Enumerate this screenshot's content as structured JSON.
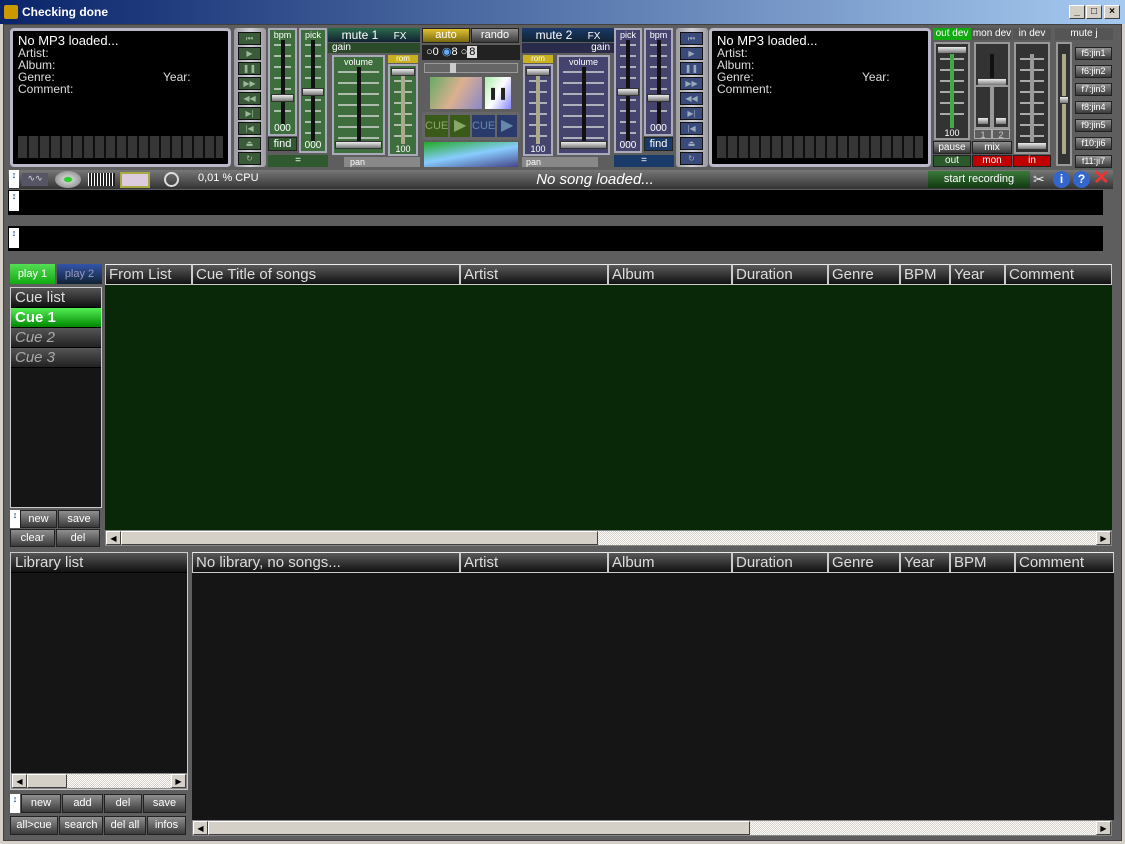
{
  "window": {
    "title": "Checking done",
    "min": "_",
    "max": "□",
    "close": "×"
  },
  "deck1": {
    "title": "No MP3 loaded...",
    "artist": "Artist:",
    "album": "Album:",
    "genre": "Genre:",
    "year": "Year:",
    "comment": "Comment:",
    "bpm_label": "bpm",
    "pitch_label": "pick",
    "bpm_value": "000",
    "pitch_value": "000",
    "find": "find",
    "mute": "mute 1",
    "fx": "FX",
    "gain": "gain",
    "volume": "volume",
    "rom": "rom",
    "rom_value": "100",
    "pan": "pan",
    "eq": "="
  },
  "deck2": {
    "title": "No MP3 loaded...",
    "artist": "Artist:",
    "album": "Album:",
    "genre": "Genre:",
    "year": "Year:",
    "comment": "Comment:",
    "bpm_label": "bpm",
    "pitch_label": "pick",
    "bpm_value": "000",
    "pitch_value": "000",
    "find": "find",
    "mute": "mute 2",
    "fx": "FX",
    "gain": "gain",
    "volume": "volume",
    "rom": "rom",
    "rom_value": "100",
    "pan": "pan",
    "eq": "="
  },
  "center": {
    "auto": "auto",
    "rando": "rando",
    "radio": [
      "0",
      "8"
    ],
    "radio_value": "8",
    "cue1": "CUE",
    "cue2": "CUE",
    "play": "▶",
    "pause": "❚❚"
  },
  "mixer": {
    "out_dev": "out dev",
    "mon_dev": "mon dev",
    "in_dev": "in dev",
    "mute_j": "mute j",
    "out_value": "100",
    "pause": "pause",
    "mix": "mix",
    "ch1": "1",
    "ch2": "2",
    "out": "out",
    "mon": "mon",
    "in": "in",
    "jingles": [
      "f5:jin1",
      "f6:jin2",
      "f7:jin3",
      "f8:jin4",
      "f9:jin5",
      "f10:ji6",
      "f11:ji7"
    ]
  },
  "toolbar": {
    "cpu": "0,01 % CPU",
    "status": "No song loaded...",
    "record": "start recording"
  },
  "tabs": {
    "play1": "play 1",
    "play2": "play 2"
  },
  "cue_table": {
    "columns": [
      "From List",
      "Cue Title of songs",
      "Artist",
      "Album",
      "Duration",
      "Genre",
      "BPM",
      "Year",
      "Comment"
    ]
  },
  "cue_list": {
    "header": "Cue list",
    "items": [
      "Cue 1",
      "Cue 2",
      "Cue 3"
    ],
    "selected": "Cue 1",
    "buttons": [
      "new",
      "save",
      "clear",
      "del"
    ]
  },
  "library": {
    "header": "Library list",
    "columns": [
      "No library, no songs...",
      "Artist",
      "Album",
      "Duration",
      "Genre",
      "Year",
      "BPM",
      "Comment"
    ],
    "buttons": [
      "new",
      "add",
      "del",
      "save",
      "all>cue",
      "search",
      "del all",
      "infos"
    ]
  },
  "colors": {
    "accent_green": "#22c022",
    "deck1": "#3e6e3e",
    "deck2": "#44446e",
    "red": "#c00000",
    "cue_bg": "#082808"
  }
}
